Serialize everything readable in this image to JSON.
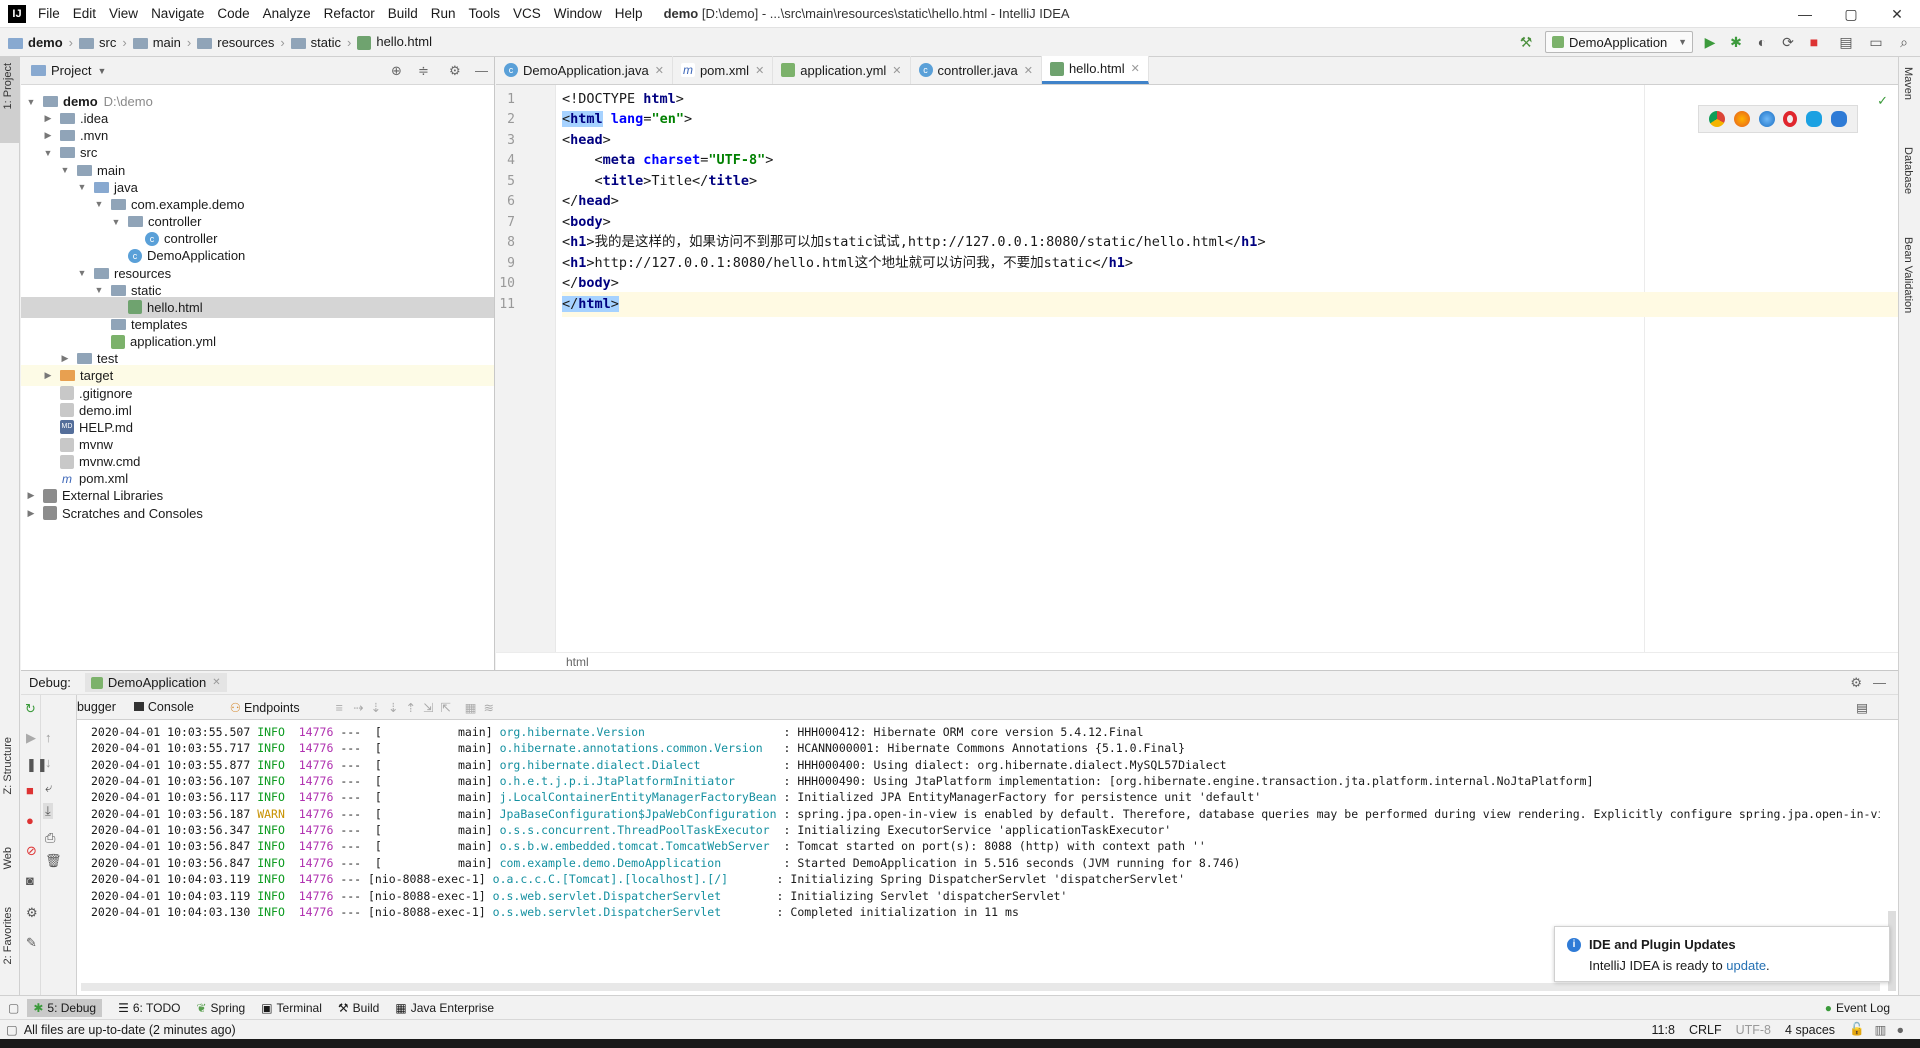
{
  "titlebar": {
    "logo": "IJ",
    "menu": [
      "File",
      "Edit",
      "View",
      "Navigate",
      "Code",
      "Analyze",
      "Refactor",
      "Build",
      "Run",
      "Tools",
      "VCS",
      "Window",
      "Help"
    ],
    "project": "demo",
    "title_rest": "[D:\\demo] - ...\\src\\main\\resources\\static\\hello.html - IntelliJ IDEA",
    "min": "—",
    "max": "▢",
    "close": "✕"
  },
  "breadcrumb": [
    "demo",
    "src",
    "main",
    "resources",
    "static",
    "hello.html"
  ],
  "run_config": "DemoApplication",
  "project_panel": {
    "title": "Project",
    "tree": [
      {
        "label": "demo",
        "extra": "D:\\demo",
        "depth": 0,
        "arrow": "▼",
        "icon": "folder",
        "bold": true
      },
      {
        "label": ".idea",
        "depth": 1,
        "arrow": "▶",
        "icon": "folder"
      },
      {
        "label": ".mvn",
        "depth": 1,
        "arrow": "▶",
        "icon": "folder"
      },
      {
        "label": "src",
        "depth": 1,
        "arrow": "▼",
        "icon": "folder"
      },
      {
        "label": "main",
        "depth": 2,
        "arrow": "▼",
        "icon": "folder"
      },
      {
        "label": "java",
        "depth": 3,
        "arrow": "▼",
        "icon": "folder-blue"
      },
      {
        "label": "com.example.demo",
        "depth": 4,
        "arrow": "▼",
        "icon": "folder"
      },
      {
        "label": "controller",
        "depth": 5,
        "arrow": "▼",
        "icon": "folder"
      },
      {
        "label": "controller",
        "depth": 6,
        "arrow": "",
        "icon": "java"
      },
      {
        "label": "DemoApplication",
        "depth": 5,
        "arrow": "",
        "icon": "java"
      },
      {
        "label": "resources",
        "depth": 3,
        "arrow": "▼",
        "icon": "folder"
      },
      {
        "label": "static",
        "depth": 4,
        "arrow": "▼",
        "icon": "folder"
      },
      {
        "label": "hello.html",
        "depth": 5,
        "arrow": "",
        "icon": "html",
        "selected": true
      },
      {
        "label": "templates",
        "depth": 4,
        "arrow": "",
        "icon": "folder"
      },
      {
        "label": "application.yml",
        "depth": 4,
        "arrow": "",
        "icon": "yml"
      },
      {
        "label": "test",
        "depth": 2,
        "arrow": "▶",
        "icon": "folder"
      },
      {
        "label": "target",
        "depth": 1,
        "arrow": "▶",
        "icon": "folder-orange",
        "highlight": true
      },
      {
        "label": ".gitignore",
        "depth": 1,
        "arrow": "",
        "icon": "file"
      },
      {
        "label": "demo.iml",
        "depth": 1,
        "arrow": "",
        "icon": "file"
      },
      {
        "label": "HELP.md",
        "depth": 1,
        "arrow": "",
        "icon": "md"
      },
      {
        "label": "mvnw",
        "depth": 1,
        "arrow": "",
        "icon": "file"
      },
      {
        "label": "mvnw.cmd",
        "depth": 1,
        "arrow": "",
        "icon": "file"
      },
      {
        "label": "pom.xml",
        "depth": 1,
        "arrow": "",
        "icon": "xml"
      },
      {
        "label": "External Libraries",
        "depth": 0,
        "arrow": "▶",
        "icon": "lib"
      },
      {
        "label": "Scratches and Consoles",
        "depth": 0,
        "arrow": "▶",
        "icon": "lib"
      }
    ]
  },
  "editor": {
    "tabs": [
      {
        "label": "DemoApplication.java",
        "icon": "java"
      },
      {
        "label": "pom.xml",
        "icon": "xml"
      },
      {
        "label": "application.yml",
        "icon": "yml"
      },
      {
        "label": "controller.java",
        "icon": "java"
      },
      {
        "label": "hello.html",
        "icon": "html",
        "active": true
      }
    ],
    "lines": [
      {
        "n": "1",
        "html": "&lt;!DOCTYPE <span class='tag'>html</span>&gt;"
      },
      {
        "n": "2",
        "html": "<span class='selbg'>&lt;<span class='tag'>html</span></span> <span class='attr'>lang</span>=<span class='str'>\"en\"</span>&gt;"
      },
      {
        "n": "3",
        "html": "&lt;<span class='tag'>head</span>&gt;"
      },
      {
        "n": "4",
        "html": "    &lt;<span class='tag'>meta</span> <span class='attr'>charset</span>=<span class='str'>\"UTF-8\"</span>&gt;"
      },
      {
        "n": "5",
        "html": "    &lt;<span class='tag'>title</span>&gt;Title&lt;/<span class='tag'>title</span>&gt;"
      },
      {
        "n": "6",
        "html": "&lt;/<span class='tag'>head</span>&gt;"
      },
      {
        "n": "7",
        "html": "&lt;<span class='tag'>body</span>&gt;"
      },
      {
        "n": "8",
        "html": "&lt;<span class='tag'>h1</span>&gt;我的是这样的，如果访问不到那可以加static试试,http://127.0.0.1:8080/static/hello.html&lt;/<span class='tag'>h1</span>&gt;"
      },
      {
        "n": "9",
        "html": "&lt;<span class='tag'>h1</span>&gt;http://127.0.0.1:8080/hello.html这个地址就可以访问我，不要加static&lt;/<span class='tag'>h1</span>&gt;"
      },
      {
        "n": "10",
        "html": "&lt;/<span class='tag'>body</span>&gt;"
      },
      {
        "n": "11",
        "html": "<span class='selbg'>&lt;/<span class='tag'>html</span>&gt;</span>",
        "current": true
      }
    ],
    "footer": "html"
  },
  "debug": {
    "label": "Debug:",
    "session": "DemoApplication",
    "tabs": [
      "Debugger",
      "Console",
      "Endpoints"
    ],
    "log": [
      {
        "ts": "2020-04-01 10:03:55.507",
        "lvl": "INFO",
        "pid": "14776",
        "thr": "---  [           main]",
        "cls": "org.hibernate.Version                   ",
        "msg": ": HHH000412: Hibernate ORM core version 5.4.12.Final"
      },
      {
        "ts": "2020-04-01 10:03:55.717",
        "lvl": "INFO",
        "pid": "14776",
        "thr": "---  [           main]",
        "cls": "o.hibernate.annotations.common.Version  ",
        "msg": ": HCANN000001: Hibernate Commons Annotations {5.1.0.Final}"
      },
      {
        "ts": "2020-04-01 10:03:55.877",
        "lvl": "INFO",
        "pid": "14776",
        "thr": "---  [           main]",
        "cls": "org.hibernate.dialect.Dialect           ",
        "msg": ": HHH000400: Using dialect: org.hibernate.dialect.MySQL57Dialect"
      },
      {
        "ts": "2020-04-01 10:03:56.107",
        "lvl": "INFO",
        "pid": "14776",
        "thr": "---  [           main]",
        "cls": "o.h.e.t.j.p.i.JtaPlatformInitiator      ",
        "msg": ": HHH000490: Using JtaPlatform implementation: [org.hibernate.engine.transaction.jta.platform.internal.NoJtaPlatform]"
      },
      {
        "ts": "2020-04-01 10:03:56.117",
        "lvl": "INFO",
        "pid": "14776",
        "thr": "---  [           main]",
        "cls": "j.LocalContainerEntityManagerFactoryBean",
        "msg": ": Initialized JPA EntityManagerFactory for persistence unit 'default'"
      },
      {
        "ts": "2020-04-01 10:03:56.187",
        "lvl": "WARN",
        "pid": "14776",
        "thr": "---  [           main]",
        "cls": "JpaBaseConfiguration$JpaWebConfiguration",
        "msg": ": spring.jpa.open-in-view is enabled by default. Therefore, database queries may be performed during view rendering. Explicitly configure spring.jpa.open-in-vie"
      },
      {
        "ts": "2020-04-01 10:03:56.347",
        "lvl": "INFO",
        "pid": "14776",
        "thr": "---  [           main]",
        "cls": "o.s.s.concurrent.ThreadPoolTaskExecutor ",
        "msg": ": Initializing ExecutorService 'applicationTaskExecutor'"
      },
      {
        "ts": "2020-04-01 10:03:56.847",
        "lvl": "INFO",
        "pid": "14776",
        "thr": "---  [           main]",
        "cls": "o.s.b.w.embedded.tomcat.TomcatWebServer ",
        "msg": ": Tomcat started on port(s): 8088 (http) with context path ''"
      },
      {
        "ts": "2020-04-01 10:03:56.847",
        "lvl": "INFO",
        "pid": "14776",
        "thr": "---  [           main]",
        "cls": "com.example.demo.DemoApplication        ",
        "msg": ": Started DemoApplication in 5.516 seconds (JVM running for 8.746)"
      },
      {
        "ts": "2020-04-01 10:04:03.119",
        "lvl": "INFO",
        "pid": "14776",
        "thr": "--- [nio-8088-exec-1]",
        "cls": "o.a.c.c.C.[Tomcat].[localhost].[/]      ",
        "msg": ": Initializing Spring DispatcherServlet 'dispatcherServlet'"
      },
      {
        "ts": "2020-04-01 10:04:03.119",
        "lvl": "INFO",
        "pid": "14776",
        "thr": "--- [nio-8088-exec-1]",
        "cls": "o.s.web.servlet.DispatcherServlet       ",
        "msg": ": Initializing Servlet 'dispatcherServlet'"
      },
      {
        "ts": "2020-04-01 10:04:03.130",
        "lvl": "INFO",
        "pid": "14776",
        "thr": "--- [nio-8088-exec-1]",
        "cls": "o.s.web.servlet.DispatcherServlet       ",
        "msg": ": Completed initialization in 11 ms"
      }
    ]
  },
  "notification": {
    "title": "IDE and Plugin Updates",
    "text": "IntelliJ IDEA is ready to ",
    "link": "update",
    "tail": "."
  },
  "left_tools": [
    "1: Project",
    "Z: Structure",
    "Web",
    "2: Favorites"
  ],
  "right_tools": [
    "Maven",
    "Database",
    "Bean Validation"
  ],
  "bottom_tools": [
    "5: Debug",
    "6: TODO",
    "Spring",
    "Terminal",
    "Build",
    "Java Enterprise"
  ],
  "event_log": "Event Log",
  "status": {
    "message": "All files are up-to-date (2 minutes ago)",
    "position": "11:8",
    "line_sep": "CRLF",
    "encoding": "UTF-8",
    "indent": "4 spaces"
  },
  "colors": {
    "accent": "#4083c9",
    "selection": "#a6d2ff",
    "info": "#0c9a1f",
    "warn": "#c79100"
  }
}
